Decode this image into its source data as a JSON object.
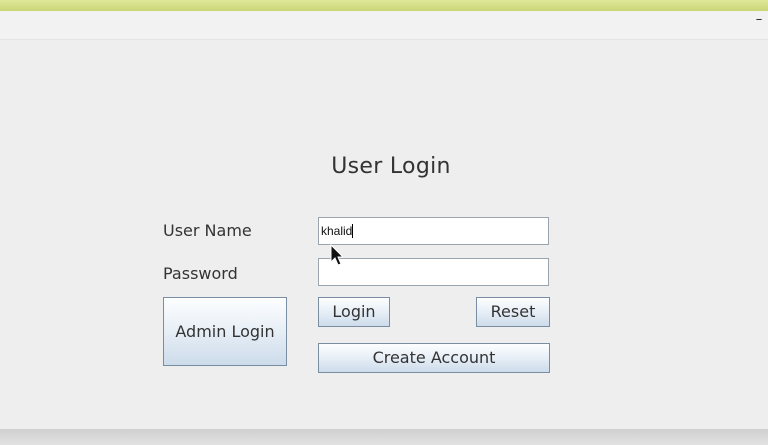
{
  "window": {
    "minimize_label": "–"
  },
  "form": {
    "title": "User Login",
    "username_label": "User Name",
    "username_value": "khalid",
    "password_label": "Password",
    "password_value": ""
  },
  "buttons": {
    "admin_login": "Admin Login",
    "login": "Login",
    "reset": "Reset",
    "create_account": "Create Account"
  },
  "colors": {
    "top_strip": "#d2dd82",
    "window_bg": "#eeeeee",
    "button_border": "#7a8ea3"
  }
}
